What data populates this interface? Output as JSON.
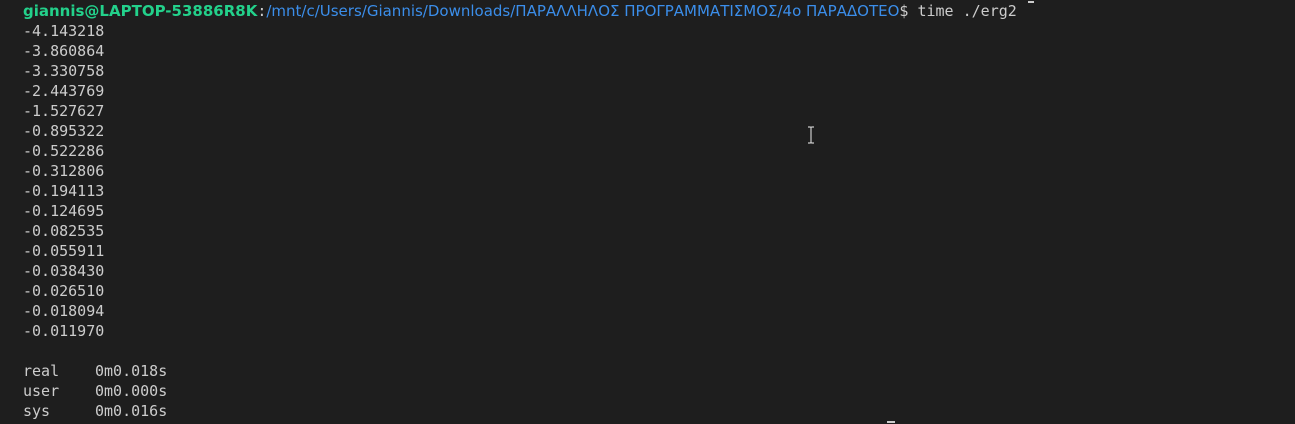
{
  "prompt": {
    "user_host": "giannis@LAPTOP-53886R8K",
    "separator": ":",
    "path": "/mnt/c/Users/Giannis/Downloads/ΠΑΡΑΛΛΗΛΟΣ ΠΡΟΓΡΑΜΜΑΤΙΣΜΟΣ/4ο ΠΑΡΑΔΟΤΕΟ",
    "symbol": "$",
    "command": " time ./erg2"
  },
  "output_lines": [
    "-4.143218",
    "-3.860864",
    "-3.330758",
    "-2.443769",
    "-1.527627",
    "-0.895322",
    "-0.522286",
    "-0.312806",
    "-0.194113",
    "-0.124695",
    "-0.082535",
    "-0.055911",
    "-0.038430",
    "-0.026510",
    "-0.018094",
    "-0.011970"
  ],
  "timing": [
    {
      "label": "real",
      "value": "0m0.018s"
    },
    {
      "label": "user",
      "value": "0m0.000s"
    },
    {
      "label": "sys",
      "value": "0m0.016s"
    }
  ],
  "colors": {
    "background": "#1e1e1e",
    "user_host": "#23d18b",
    "path": "#3b8eea",
    "text": "#cccccc"
  },
  "icons": {
    "mouse_cursor": "ibeam-cursor-icon"
  }
}
